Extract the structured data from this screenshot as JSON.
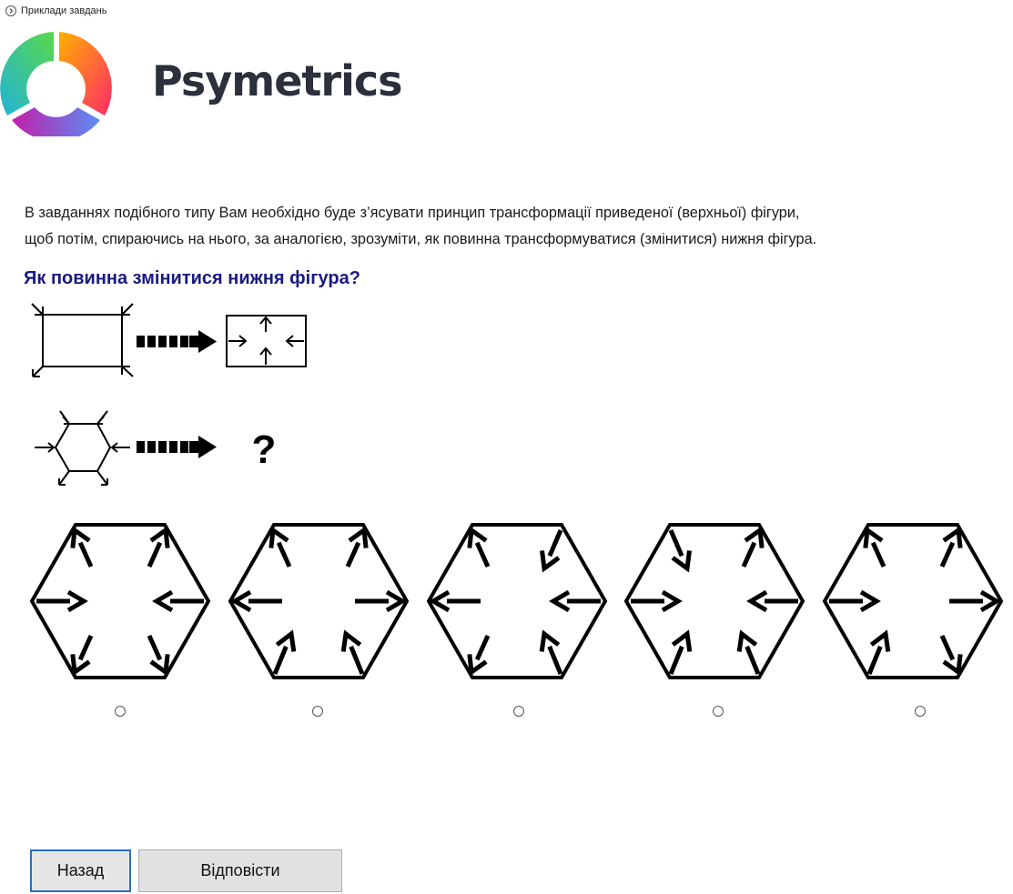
{
  "breadcrumb": {
    "label": "Приклади завдань",
    "icon": "chevron-right-circle-icon"
  },
  "header": {
    "brand": "Psymetrics"
  },
  "instructions": {
    "line1": "В завданнях подібного типу Вам необхідно буде з’ясувати принцип трансформації приведеної (верхньої) фігури,",
    "line2": "щоб потім, спираючись на нього, за аналогією, зрозуміти, як повинна трансформуватися (змінитися) нижня фігура."
  },
  "question": "Як повинна змінитися нижня фігура?",
  "puzzle": {
    "unknown_mark": "?"
  },
  "options": [
    {
      "index": 1,
      "selected": false
    },
    {
      "index": 2,
      "selected": false
    },
    {
      "index": 3,
      "selected": false
    },
    {
      "index": 4,
      "selected": false
    },
    {
      "index": 5,
      "selected": false
    }
  ],
  "buttons": {
    "back": "Назад",
    "answer": "Відповісти"
  },
  "colors": {
    "brand_text": "#2c2f3c",
    "question_text": "#1a1a80",
    "focus_border": "#2a6fc9"
  }
}
